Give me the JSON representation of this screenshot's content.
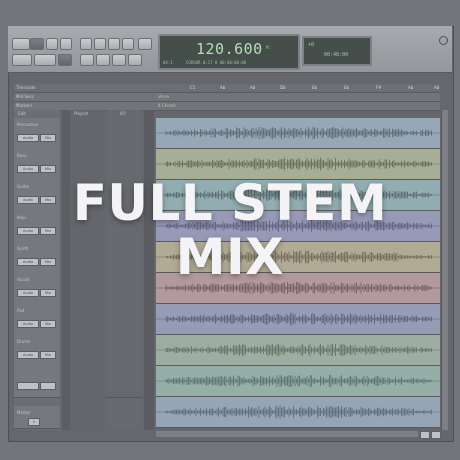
{
  "transport": {
    "counter_main": "120.600",
    "counter_unit": "M:",
    "counter_sub_left": "04:1",
    "counter_sub_mid": "CURSOR  0:17  H  00:00:00:08",
    "mini_line1": "+0",
    "mini_line2": "00:48:00"
  },
  "rulers": {
    "row1": "Timecode",
    "row2": "Min:Secs",
    "row3": "Markers",
    "markers": [
      "C1",
      "Ab",
      "Ab",
      "Db",
      "Eb",
      "Eb",
      "F#",
      "Ab",
      "Ab"
    ],
    "row3_right": "4 Chords",
    "row2_right": "Verse"
  },
  "columns": {
    "edit": "Edit",
    "playlist": "Playlist",
    "input": "I/O"
  },
  "tracks": [
    {
      "name": "Percussion",
      "btn1": "Audio",
      "btn2": "Mix",
      "color": "#8fa7b8",
      "wave": "#3c4c5a"
    },
    {
      "name": "Bass",
      "btn1": "Audio",
      "btn2": "Mix",
      "color": "#a6b08a",
      "wave": "#4a5238"
    },
    {
      "name": "Guitar",
      "btn1": "Audio",
      "btn2": "Mix",
      "color": "#8aaeb0",
      "wave": "#3a5052"
    },
    {
      "name": "Keys",
      "btn1": "Audio",
      "btn2": "Mix",
      "color": "#8f94b8",
      "wave": "#3e4266"
    },
    {
      "name": "Synth",
      "btn1": "Audio",
      "btn2": "Mix",
      "color": "#b4a98a",
      "wave": "#5a4e36"
    },
    {
      "name": "Vocals",
      "btn1": "Audio",
      "btn2": "Mix",
      "color": "#b49296",
      "wave": "#5c3c40"
    },
    {
      "name": "Pad",
      "btn1": "Audio",
      "btn2": "Mix",
      "color": "#8f95b8",
      "wave": "#3e4268"
    },
    {
      "name": "Drums",
      "btn1": "Audio",
      "btn2": "Mix",
      "color": "#9aae9a",
      "wave": "#435a43"
    },
    {
      "name": "",
      "btn1": "",
      "btn2": "",
      "color": "#8eb0a4",
      "wave": "#3b5a4e"
    },
    {
      "name": "",
      "btn1": "",
      "btn2": "",
      "color": "#8fa3b8",
      "wave": "#3c4e64"
    }
  ],
  "footer": {
    "master_label": "Master",
    "btn": "0"
  },
  "overlay": {
    "line1": "FULL STEM",
    "line2": "MIX"
  }
}
